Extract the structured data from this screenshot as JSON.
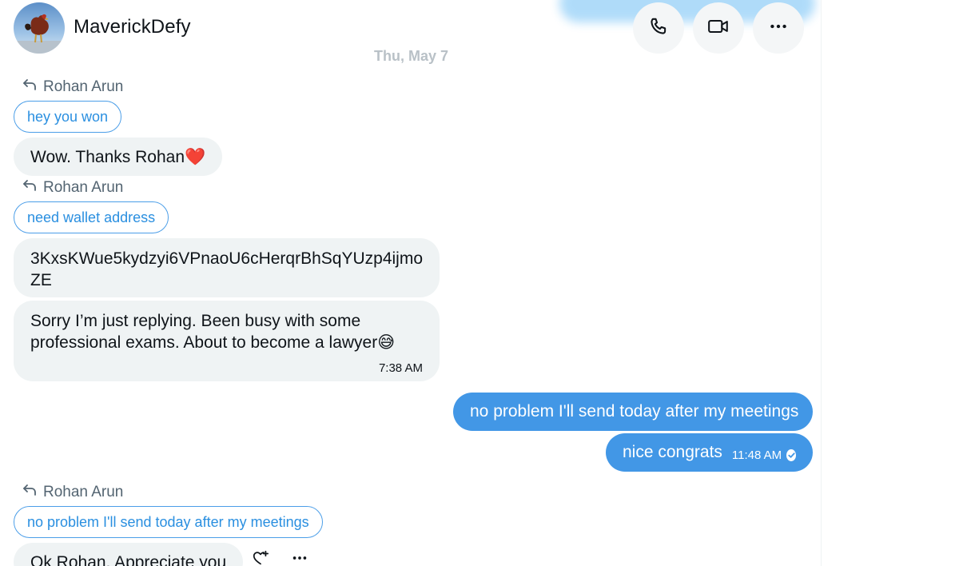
{
  "header": {
    "name": "MaverickDefy",
    "date": "Thu, May 7"
  },
  "colors": {
    "accent": "#1d9bf0",
    "outgoing_bubble": "#4297e6",
    "incoming_bubble": "#eff3f4",
    "reply_border": "#4b9ee8"
  },
  "icons": [
    "phone-icon",
    "video-call-icon",
    "more-icon",
    "reply-arrow-icon",
    "react-icon",
    "read-check-icon"
  ],
  "messages": [
    {
      "reply_to": "Rohan Arun",
      "quote": "hey you won",
      "text": "Wow. Thanks Rohan❤️"
    },
    {
      "reply_to": "Rohan Arun",
      "quote": "need wallet address",
      "text": "3KxsKWue5kydzyi6VPnaoU6cHerqrBhSqYUzp4ijmo ZE"
    },
    {
      "text": "Sorry I’m just replying. Been busy with some professional exams. About to become a lawyer😅",
      "time": "7:38 AM"
    },
    {
      "outgoing": true,
      "text": "no problem I'll send today after my meetings"
    },
    {
      "outgoing": true,
      "text": "nice congrats",
      "time": "11:48 AM"
    },
    {
      "reply_to": "Rohan Arun",
      "quote": "no problem I'll send today after my meetings",
      "text": "Ok Rohan. Appreciate you"
    }
  ]
}
